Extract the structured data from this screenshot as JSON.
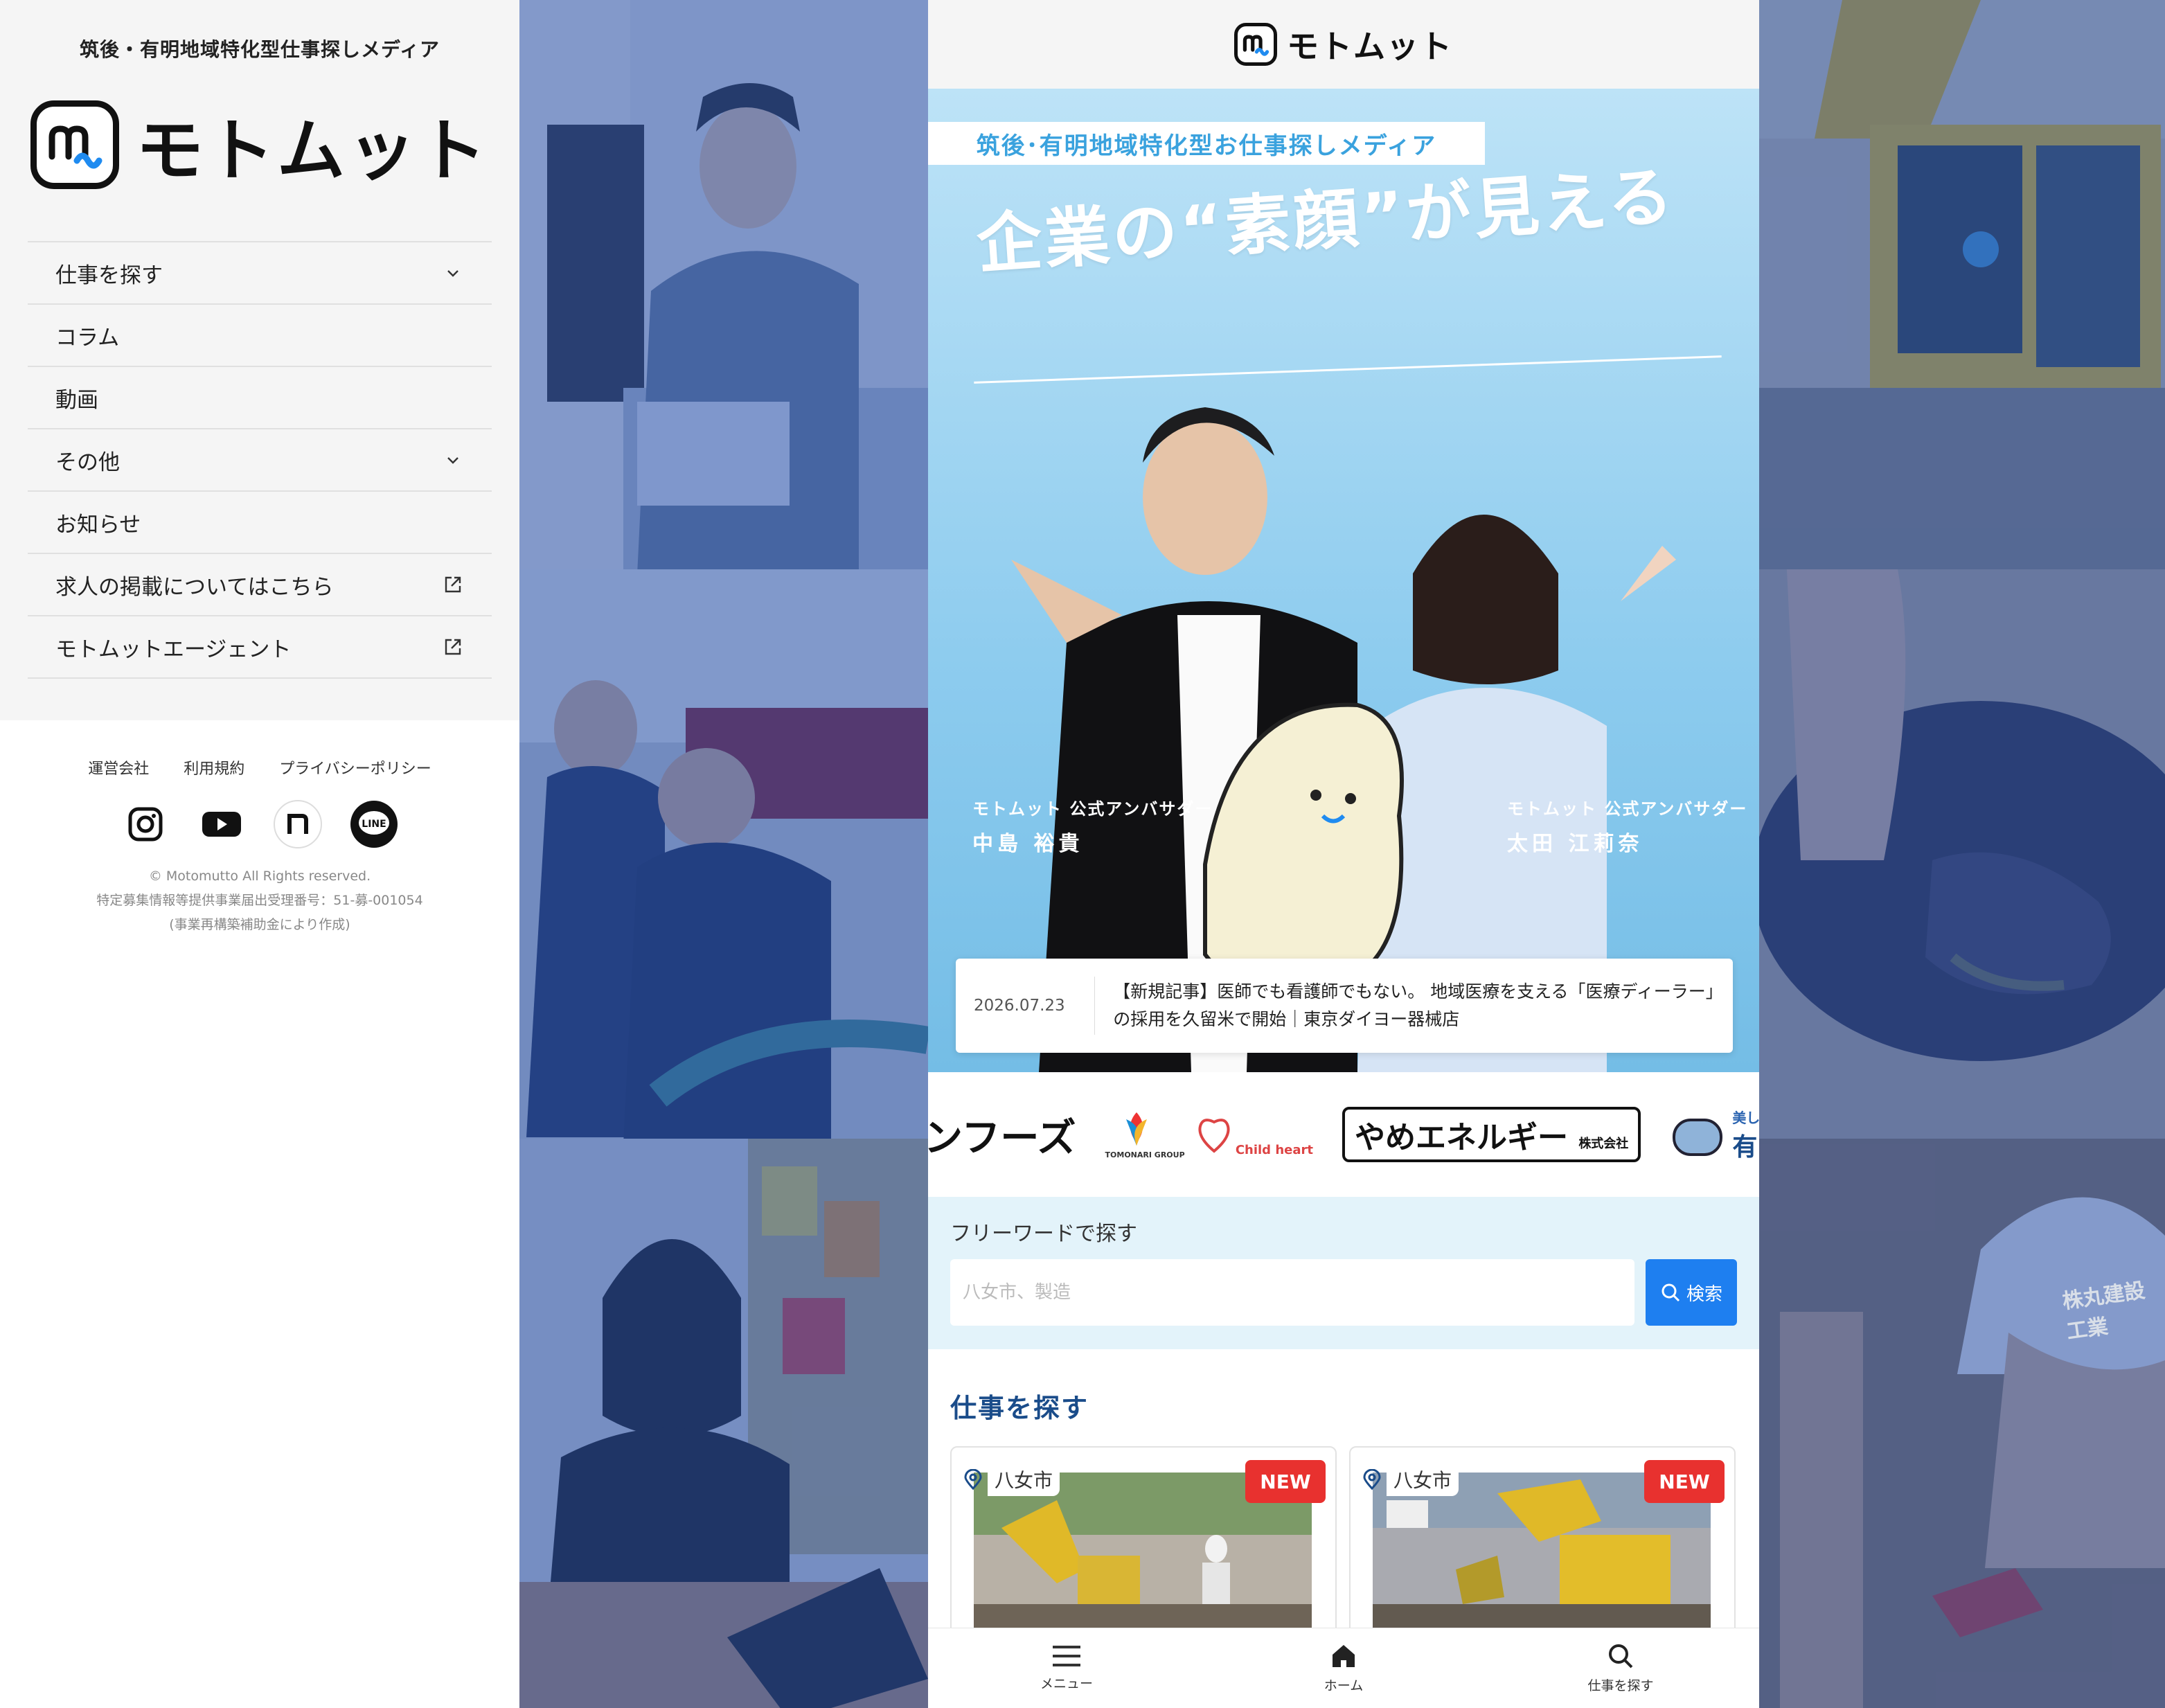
{
  "sidebar": {
    "tagline": "筑後・有明地域特化型仕事探しメディア",
    "logo_text": "モトムット",
    "menu": [
      {
        "label": "仕事を探す",
        "icon": "chevron-down-icon"
      },
      {
        "label": "コラム",
        "icon": ""
      },
      {
        "label": "動画",
        "icon": ""
      },
      {
        "label": "その他",
        "icon": "chevron-down-icon"
      },
      {
        "label": "お知らせ",
        "icon": ""
      },
      {
        "label": "求人の掲載についてはこちら",
        "icon": "external-link-icon"
      },
      {
        "label": "モトムットエージェント",
        "icon": "external-link-icon"
      }
    ],
    "footer_links": [
      "運営会社",
      "利用規約",
      "プライバシーポリシー"
    ],
    "social": [
      "instagram-icon",
      "youtube-icon",
      "note-icon",
      "line-icon"
    ],
    "line_label": "LINE",
    "copyright": "© Motomutto All Rights reserved.",
    "license": "特定募集情報等提供事業届出受理番号：51-募-001054",
    "subsidy": "(事業再構築補助金により作成)"
  },
  "phone": {
    "logo_text": "モトムット",
    "hero": {
      "banner": "筑後･有明地域特化型お仕事探しメディア",
      "headline": "企業の“素顔”が見える",
      "ambassador_left_title": "モトムット 公式アンバサダー",
      "ambassador_left_name": "中島 裕貴",
      "ambassador_right_title": "モトムット 公式アンバサダー",
      "ambassador_right_name": "太田 江莉奈"
    },
    "news": {
      "date": "2026.07.23",
      "title": "【新規記事】医師でも看護師でもない。 地域医療を支える「医療ディーラー」の採用を久留米で開始｜東京ダイヨー器械店"
    },
    "logos": [
      "ンフーズ",
      "TOMONARI GROUP",
      "Child heart",
      "やめエネルギー",
      "株式会社",
      "美しい水を未来へ",
      "有限会社 広川"
    ],
    "search": {
      "label": "フリーワードで探す",
      "placeholder": "八女市、製造",
      "button": "検索"
    },
    "jobs_title": "仕事を探す",
    "jobs": [
      {
        "location": "八女市",
        "badge": "NEW"
      },
      {
        "location": "八女市",
        "badge": "NEW"
      }
    ],
    "bottom_nav": [
      {
        "label": "メニュー",
        "icon": "menu-icon"
      },
      {
        "label": "ホーム",
        "icon": "home-icon"
      },
      {
        "label": "仕事を探す",
        "icon": "search-icon"
      }
    ],
    "right_photo_label": "株丸建設工業"
  },
  "colors": {
    "accent": "#1e7ff0",
    "brand_blue": "#1f8bf0",
    "new_badge": "#e8312f",
    "heading": "#1a4c8a",
    "search_bg": "#e3f3fa",
    "photo_tint": "#2850aa"
  }
}
